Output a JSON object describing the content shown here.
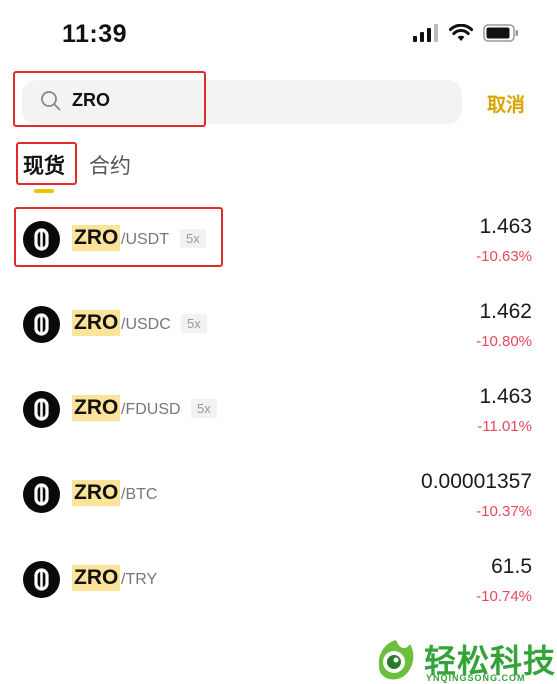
{
  "status_bar": {
    "time": "11:39"
  },
  "search": {
    "query": "ZRO",
    "cancel_label": "取消"
  },
  "tabs": [
    {
      "label": "现货",
      "active": true
    },
    {
      "label": "合约",
      "active": false
    }
  ],
  "pairs": [
    {
      "base": "ZRO",
      "quote": "/USDT",
      "leverage": "5x",
      "price": "1.463",
      "change": "-10.63%"
    },
    {
      "base": "ZRO",
      "quote": "/USDC",
      "leverage": "5x",
      "price": "1.462",
      "change": "-10.80%"
    },
    {
      "base": "ZRO",
      "quote": "/FDUSD",
      "leverage": "5x",
      "price": "1.463",
      "change": "-11.01%"
    },
    {
      "base": "ZRO",
      "quote": "/BTC",
      "leverage": "",
      "price": "0.00001357",
      "change": "-10.37%"
    },
    {
      "base": "ZRO",
      "quote": "/TRY",
      "leverage": "",
      "price": "61.5",
      "change": "-10.74%"
    }
  ],
  "watermark": {
    "title": "轻松科技",
    "subtitle": "YNQINGSONG.COM"
  },
  "colors": {
    "accent": "#d9a400",
    "negative": "#e8475d",
    "highlight": "#fbe39a",
    "annotation": "#e02b2b",
    "watermark": "#33a33a"
  },
  "icons": [
    "cellular-signal-icon",
    "wifi-icon",
    "battery-icon",
    "search-icon",
    "zro-coin-logo"
  ]
}
